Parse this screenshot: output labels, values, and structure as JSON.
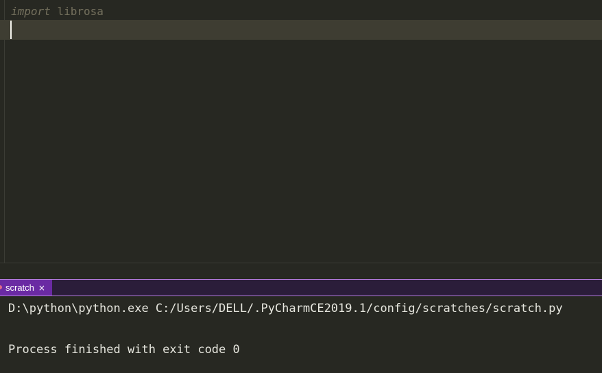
{
  "editor": {
    "line1": {
      "keyword": "import",
      "module": " librosa"
    }
  },
  "run_panel": {
    "tab": {
      "label": "scratch",
      "close_glyph": "×",
      "close_icon": "close-icon"
    },
    "console": {
      "command": "D:\\python\\python.exe C:/Users/DELL/.PyCharmCE2019.1/config/scratches/scratch.py",
      "exit_message": "Process finished with exit code 0"
    }
  },
  "colors": {
    "editor_bg": "#272822",
    "current_line_bg": "#3e3d32",
    "comment_text": "#75715e",
    "tab_bg": "#6a2aa3",
    "console_text": "#e6e6de"
  }
}
